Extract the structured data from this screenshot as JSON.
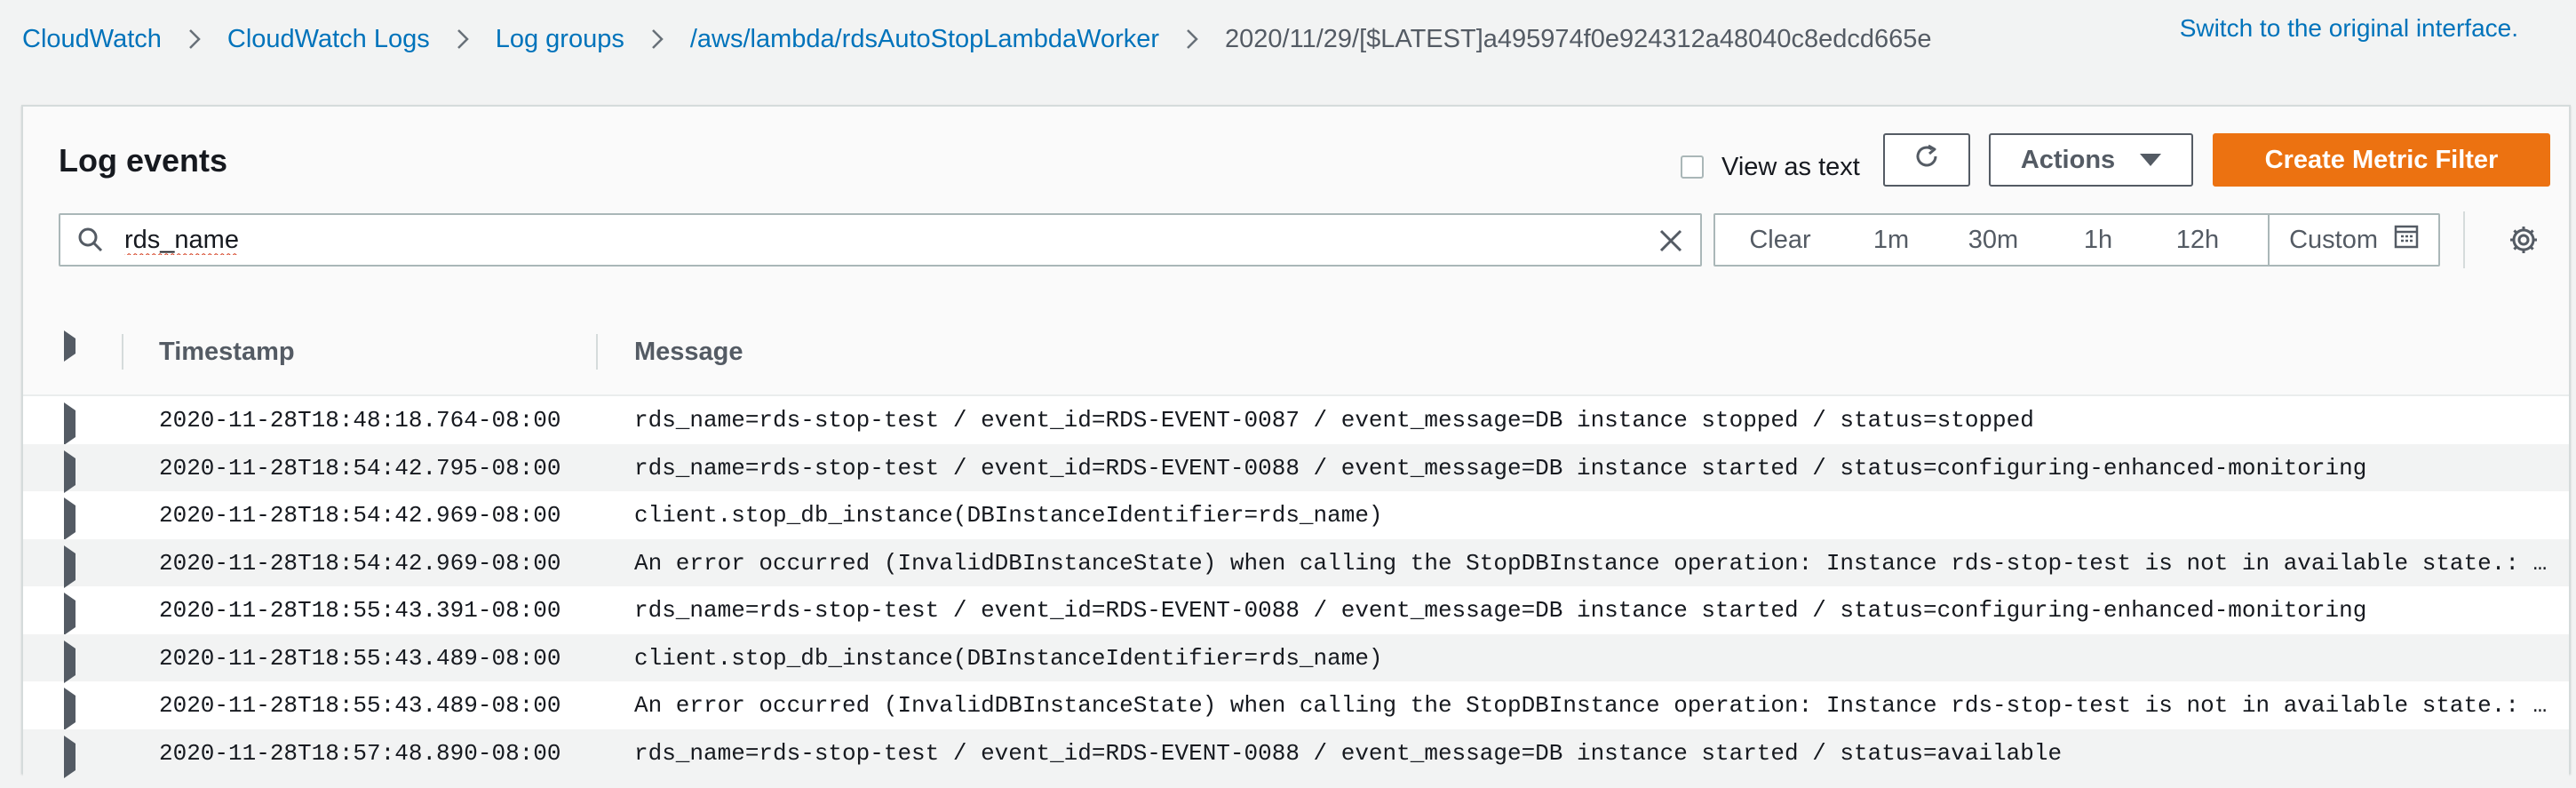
{
  "breadcrumb": {
    "items": [
      "CloudWatch",
      "CloudWatch Logs",
      "Log groups",
      "/aws/lambda/rdsAutoStopLambdaWorker"
    ],
    "current": "2020/11/29/[$LATEST]a495974f0e924312a48040c8edcd665e"
  },
  "switch_link": "Switch to the original interface.",
  "panel": {
    "title": "Log events",
    "view_as_text": "View as text",
    "actions_label": "Actions",
    "create_metric_filter": "Create Metric Filter"
  },
  "search": {
    "value": "rds_name"
  },
  "time_range": {
    "clear": "Clear",
    "options": [
      "1m",
      "30m",
      "1h",
      "12h"
    ],
    "custom": "Custom"
  },
  "columns": {
    "timestamp": "Timestamp",
    "message": "Message"
  },
  "rows": [
    {
      "timestamp": "2020-11-28T18:48:18.764-08:00",
      "message": "rds_name=rds-stop-test / event_id=RDS-EVENT-0087 / event_message=DB instance stopped / status=stopped"
    },
    {
      "timestamp": "2020-11-28T18:54:42.795-08:00",
      "message": "rds_name=rds-stop-test / event_id=RDS-EVENT-0088 / event_message=DB instance started / status=configuring-enhanced-monitoring"
    },
    {
      "timestamp": "2020-11-28T18:54:42.969-08:00",
      "message": "client.stop_db_instance(DBInstanceIdentifier=rds_name)"
    },
    {
      "timestamp": "2020-11-28T18:54:42.969-08:00",
      "message": "An error occurred (InvalidDBInstanceState) when calling the StopDBInstance operation: Instance rds-stop-test is not in available state.: Invali…"
    },
    {
      "timestamp": "2020-11-28T18:55:43.391-08:00",
      "message": "rds_name=rds-stop-test / event_id=RDS-EVENT-0088 / event_message=DB instance started / status=configuring-enhanced-monitoring"
    },
    {
      "timestamp": "2020-11-28T18:55:43.489-08:00",
      "message": "client.stop_db_instance(DBInstanceIdentifier=rds_name)"
    },
    {
      "timestamp": "2020-11-28T18:55:43.489-08:00",
      "message": "An error occurred (InvalidDBInstanceState) when calling the StopDBInstance operation: Instance rds-stop-test is not in available state.: Invali…"
    },
    {
      "timestamp": "2020-11-28T18:57:48.890-08:00",
      "message": "rds_name=rds-stop-test / event_id=RDS-EVENT-0088 / event_message=DB instance started / status=available"
    }
  ],
  "icons": {
    "search": "search-icon",
    "clear": "close-icon",
    "refresh": "refresh-icon",
    "caret": "caret-down-icon",
    "calendar": "calendar-icon",
    "settings": "gear-icon",
    "expand": "expand-triangle-icon",
    "chevron": "chevron-right-icon"
  },
  "colors": {
    "link": "#0073bb",
    "primary_button": "#ec7211",
    "background": "#f2f3f3"
  }
}
